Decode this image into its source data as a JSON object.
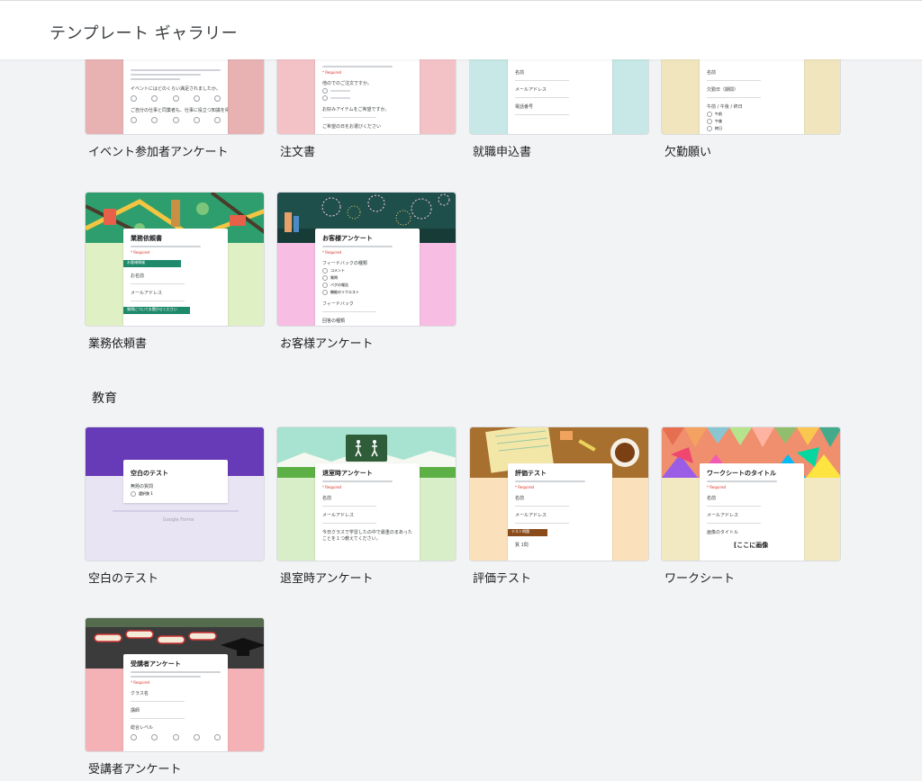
{
  "header": {
    "title": "テンプレート ギャラリー"
  },
  "top_row": [
    {
      "label": "イベント参加者アンケート",
      "thumb_color": "#e8b2b3"
    },
    {
      "label": "注文書",
      "thumb_color": "#f3c2c6"
    },
    {
      "label": "就職申込書",
      "thumb_color": "#c7e8e6"
    },
    {
      "label": "欠勤願い",
      "thumb_color": "#f0e5bd"
    }
  ],
  "mid_row": [
    {
      "label": "業務依頼書",
      "thumb_color": "#dff0c4"
    },
    {
      "label": "お客様アンケート",
      "thumb_color": "#f8bde3"
    }
  ],
  "section_education": {
    "title": "教育"
  },
  "education_row": [
    {
      "label": "空白のテスト",
      "thumb_color": "#e9e4f4"
    },
    {
      "label": "退室時アンケート",
      "thumb_color": "#d7eec8"
    },
    {
      "label": "評価テスト",
      "thumb_color": "#fbe1bb"
    },
    {
      "label": "ワークシート",
      "thumb_color": "#f2e9c3"
    }
  ],
  "last_row": [
    {
      "label": "受講者アンケート",
      "thumb_color": "#f4b2b6"
    }
  ],
  "previews": {
    "event_q1": "イベントにはどのくらい満足されましたか。",
    "event_q2": "ご自分の仕事と同業者も、仕事に役立つ知識を得られましたか。",
    "order_q1": "他のでのご注文ですか。",
    "order_q2": "お好みアイテムをご希望ですか。",
    "order_q3": "ご希望の日をお選びください",
    "job_q1": "名前",
    "job_q2": "メールアドレス",
    "job_q3": "電話番号",
    "absence_q1": "名前",
    "absence_q2": "欠勤日（期間）",
    "absence_q3": "午前 / 午後 / 終日",
    "absence_o1": "午前",
    "absence_o2": "午後",
    "absence_o3": "終日",
    "work_title": "業務依頼書",
    "work_band": "お客様情報",
    "work_q1": "お名前",
    "work_q2": "メールアドレス",
    "work_band2": "質問についてお聞かせください",
    "customer_title": "お客様アンケート",
    "customer_q1": "フィードバックの種類",
    "customer_o1": "コメント",
    "customer_o2": "質問",
    "customer_o3": "バグの報告",
    "customer_o4": "機能のリクエスト",
    "customer_q2": "フィードバック",
    "customer_q3": "回答の種類",
    "blank_title": "空白のテスト",
    "blank_q": "無題の質問",
    "blank_o": "選択肢 1",
    "blank_footer": "Google Forms",
    "exit_title": "退室時アンケート",
    "exit_q1": "名前",
    "exit_q2": "メールアドレス",
    "exit_q3": "今日クラスで学習したの中で最重のまあったことを１つ教えてください。",
    "eval_title": "評価テスト",
    "eval_q1": "名前",
    "eval_q2": "メールアドレス",
    "eval_band": "テスト問題",
    "eval_q3": "質 1問",
    "ws_title": "ワークシートのタイトル",
    "ws_q1": "名前",
    "ws_q2": "メールアドレス",
    "ws_q3": "画像のタイトル",
    "ws_q4": "[ここに画像",
    "stu_title": "受講者アンケート",
    "stu_q1": "クラス名",
    "stu_q2": "講師",
    "stu_q3": "総合レベル"
  }
}
